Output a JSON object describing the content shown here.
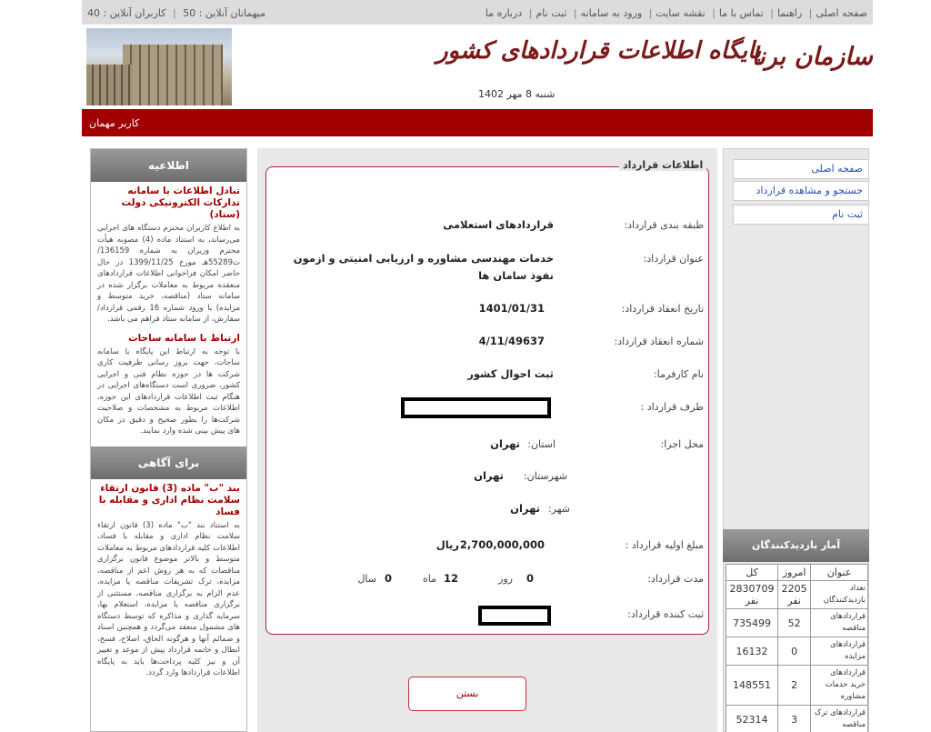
{
  "topbar": {
    "nav": [
      "صفحه اصلی",
      "راهنما",
      "تماس با ما",
      "نقشه سایت",
      "ورود به سامانه",
      "ثبت نام",
      "درباره ما"
    ],
    "online_guests": "میهمانان آنلاین : 50",
    "online_users": "کاربران آنلاین : 40"
  },
  "header": {
    "logo_left": "سازمان برنامه و بودجه",
    "logo_main": "پایگاه اطلاعات قراردادهای کشور",
    "date": "شنبه 8 مهر 1402"
  },
  "user": {
    "label": "کاربر مهمان"
  },
  "left": {
    "panel1_title": "اطلاعیه",
    "news1_title": "تبادل اطلاعات با سامانه تدارکات الکترونیکی دولت (ستاد)",
    "news1_body": "به اطلاع کاربران محترم دستگاه های اجرایی می‌رساند، به استناد ماده (4) مصوبه هیأت محترم وزیران به شماره 136159/ت55289هـ مورخ 1399/11/25 در حال حاضر امکان فراخوانی اطلاعات قراردادهای منعقده مربوط به معاملات برگزار شده در سامانه ستاد (مناقصه، خرید متوسط و مزایده) با ورود شماره 16 رقمی قرارداد/ سفارش، از سامانه ستاد فراهم می باشد.",
    "news2_title": "ارتباط با سامانه ساجات",
    "news2_body": "با توجه به ارتباط این پایگاه با سامانه ساجات، جهت بروز رسانی ظرفیت کاری شرکت ها در حوزه نظام فنی و اجرایی کشور، ضروری است دستگاه‌های اجرایی در هنگام ثبت اطلاعات قراردادهای این حوزه، اطلاعات مربوط به مشخصات و صلاحیت شرکت‌ها را بطور صحیح و دقیق در مکان های پیش بینی شده وارد نمایند.",
    "panel2_title": "برای آگاهی",
    "news3_title": "بند \"ب\" ماده (3) قانون ارتقاء سلامت نظام اداری و مقابله با فساد",
    "news3_body": "به استناد بند \"ب\" ماده (3) قانون ارتقاء سلامت نظام اداری و مقابله با فساد، اطلاعات کلیه قراردادهای مربوط به معاملات متوسط و بالاتر موضوع قانون برگزاری مناقصات که به هر روش اعم از مناقصه، مزایده، ترک تشریفات مناقصه یا مزایده، عدم الزام به برگزاری مناقصه، مستثنی از برگزاری مناقصه یا مزایده، استعلام بها، سرمایه گذاری و مذاکره که توسط دستگاه های مشمول منعقد می‌گردد و همچنین اسناد و ضمائم آنها و هرگونه الحاق، اصلاح، فسخ، ابطال و خاتمه قرارداد پیش از موعد و تغییر آن و نیز کلیه پرداخت‌ها باید به پایگاه اطلاعات قراردادها وارد گردد."
  },
  "contract": {
    "legend": "اطلاعات قرارداد",
    "category_label": "طبقه بندی قرارداد:",
    "category_value": "قراردادهای استعلامی",
    "title_label": "عنوان قرارداد:",
    "title_value_1": "خدمات مهندسی مشاوره و ارزیابی امنیتی و ازمون",
    "title_value_2": "نفوذ سامان ها",
    "date_label": "تاریخ انعقاد قرارداد:",
    "date_value": "1401/01/31",
    "number_label": "شماره انعقاد قرارداد:",
    "number_value": "4/11/49637",
    "employer_label": "نام کارفرما:",
    "employer_value": "ثبت احوال کشور",
    "party_label": "طرف قرارداد :",
    "location_label": "محل اجرا:",
    "province_label": "استان:",
    "province_value": "تهران",
    "county_label": "شهرستان:",
    "county_value": "تهران",
    "city_label": "شهر:",
    "city_value": "تهران",
    "amount_label": "مبلغ اولیه قرارداد :",
    "amount_value": "2,700,000,000",
    "amount_unit": "ریال",
    "duration_label": "مدت قرارداد:",
    "days_value": "0",
    "days_unit": "روز",
    "months_value": "12",
    "months_unit": "ماه",
    "years_value": "0",
    "years_unit": "سال",
    "registrar_label": "ثبت کننده قرارداد:",
    "close_label": "بستن"
  },
  "menu": [
    "صفحه اصلی",
    "جستجو و مشاهده قرارداد",
    "ثبت نام"
  ],
  "stats": {
    "title": "آمار بازدیدکنندگان",
    "headers": [
      "عنوان",
      "امروز",
      "کل"
    ],
    "rows": [
      [
        "تعداد بازدیدکنندگان",
        "2205 نفر",
        "2830709 نفر"
      ],
      [
        "قراردادهای مناقصه",
        "52",
        "735499"
      ],
      [
        "قراردادهای مزایده",
        "0",
        "16132"
      ],
      [
        "قراردادهای خرید خدمات مشاوره",
        "2",
        "148551"
      ],
      [
        "قراردادهای ترک مناقصه",
        "3",
        "52314"
      ]
    ]
  },
  "colors": {
    "accent_red": "#a00000",
    "border_red": "#a52a2a",
    "link_blue": "#2a50b0"
  }
}
